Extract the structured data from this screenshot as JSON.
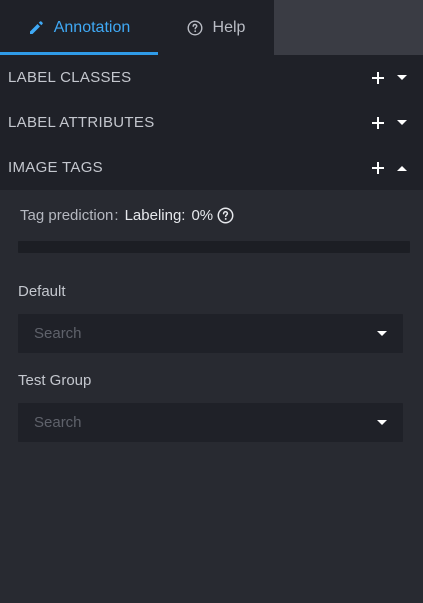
{
  "tabs": {
    "annotation_label": "Annotation",
    "help_label": "Help"
  },
  "sections": {
    "label_classes": "LABEL CLASSES",
    "label_attributes": "LABEL ATTRIBUTES",
    "image_tags": "IMAGE TAGS"
  },
  "tag_prediction": {
    "label": "Tag prediction",
    "separator": ":",
    "status_label": "Labeling:",
    "percent": "0%",
    "progress": 0
  },
  "groups": [
    {
      "name": "Default",
      "placeholder": "Search"
    },
    {
      "name": "Test Group",
      "placeholder": "Search"
    }
  ],
  "colors": {
    "accent": "#2f9be8",
    "panel_bg": "#1f2128",
    "body_bg": "#282a31"
  }
}
